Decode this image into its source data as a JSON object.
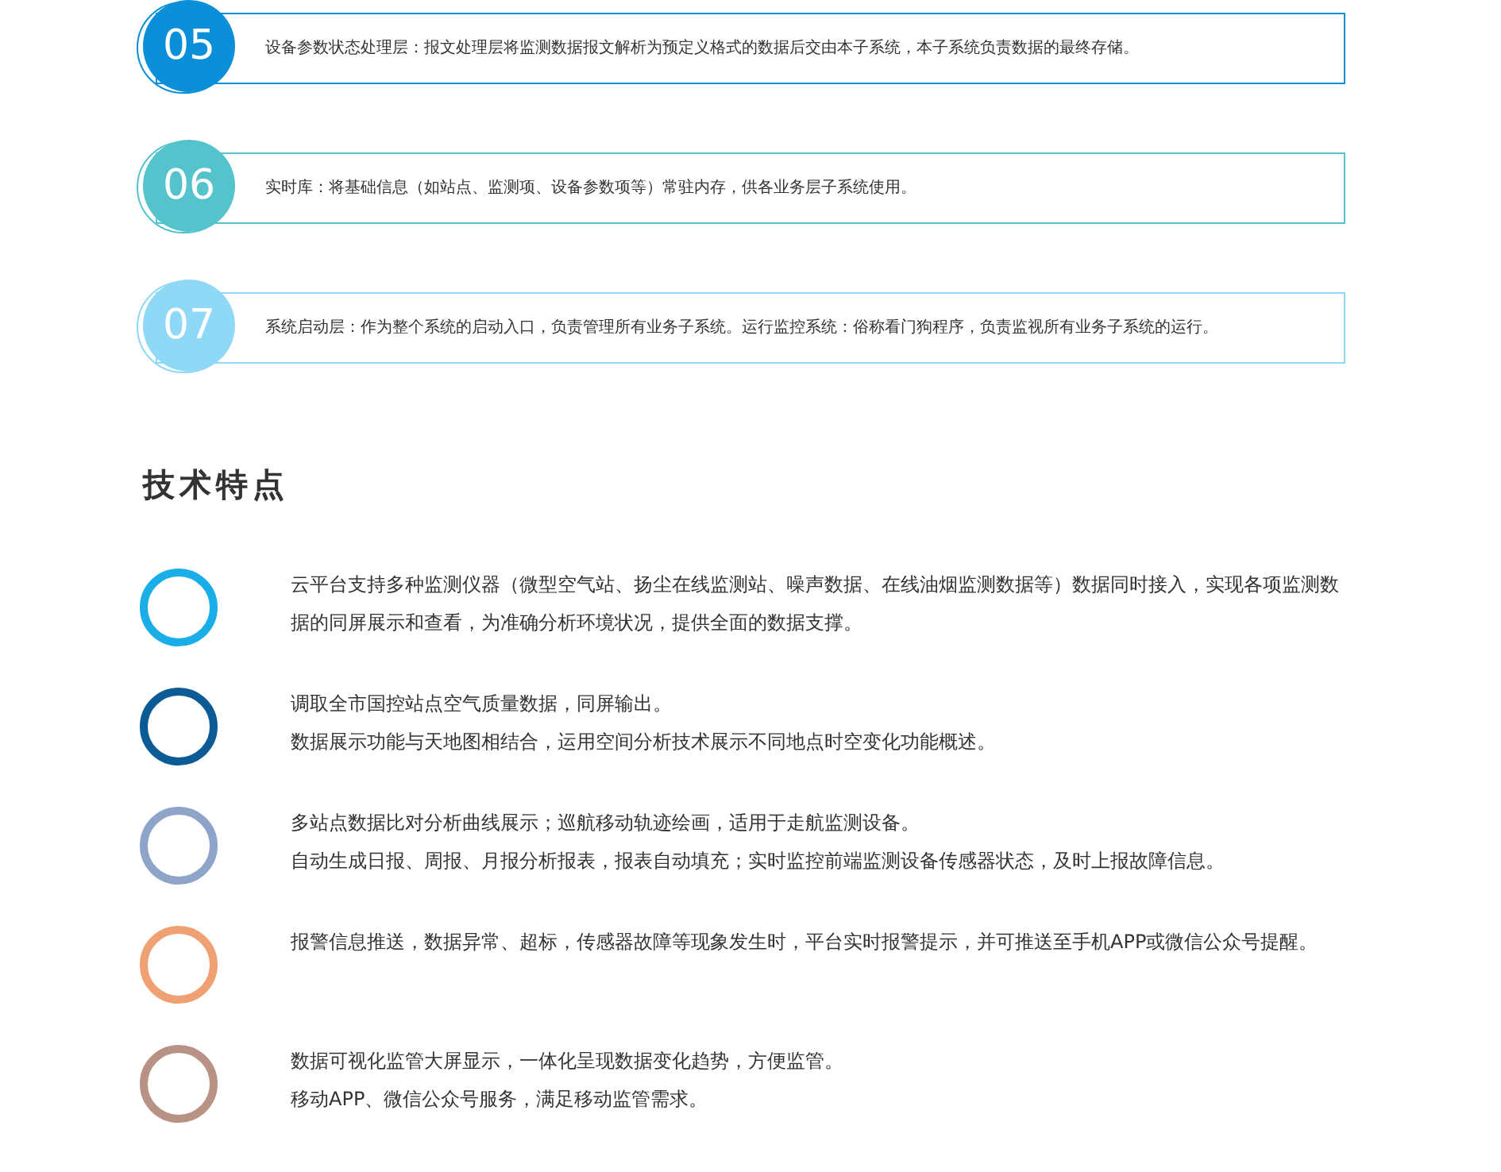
{
  "layers": [
    {
      "number": "05",
      "text": "设备参数状态处理层：报文处理层将监测数据报文解析为预定义格式的数据后交由本子系统，本子系统负责数据的最终存储。",
      "color": "#0a8fd8"
    },
    {
      "number": "06",
      "text": "实时库：将基础信息（如站点、监测项、设备参数项等）常驻内存，供各业务层子系统使用。",
      "color": "#55c3cb"
    },
    {
      "number": "07",
      "text": "系统启动层：作为整个系统的启动入口，负责管理所有业务子系统。运行监控系统：俗称看门狗程序，负责监视所有业务子系统的运行。",
      "color": "#8fd8f6"
    }
  ],
  "section_title": "技术特点",
  "features": [
    {
      "color": "#1aaee9",
      "lines": [
        "云平台支持多种监测仪器（微型空气站、扬尘在线监测站、噪声数据、在线油烟监测数据等）数据同时接入，实现各项监测数据的同屏展示和查看，为准确分析环境状况，提供全面的数据支撑。"
      ]
    },
    {
      "color": "#0c5b95",
      "lines": [
        "调取全市国控站点空气质量数据，同屏输出。",
        "数据展示功能与天地图相结合，运用空间分析技术展示不同地点时空变化功能概述。"
      ]
    },
    {
      "color": "#8fa4c9",
      "lines": [
        "多站点数据比对分析曲线展示；巡航移动轨迹绘画，适用于走航监测设备。",
        "自动生成日报、周报、月报分析报表，报表自动填充；实时监控前端监测设备传感器状态，及时上报故障信息。"
      ]
    },
    {
      "color": "#f0a173",
      "lines": [
        "报警信息推送，数据异常、超标，传感器故障等现象发生时，平台实时报警提示，并可推送至手机APP或微信公众号提醒。"
      ]
    },
    {
      "color": "#b89284",
      "lines": [
        "数据可视化监管大屏显示，一体化呈现数据变化趋势，方便监管。",
        "移动APP、微信公众号服务，满足移动监管需求。"
      ]
    }
  ]
}
